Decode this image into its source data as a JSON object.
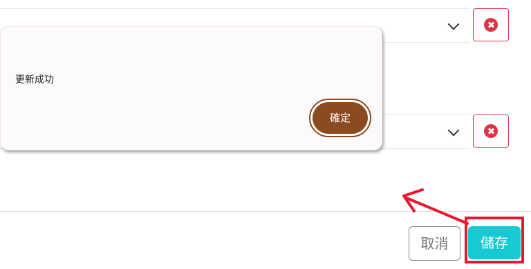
{
  "dialog": {
    "message": "更新成功",
    "confirm_label": "確定"
  },
  "form": {
    "rows": [
      {
        "remove_icon": "x-circle-icon"
      },
      {
        "remove_icon": "x-circle-icon"
      }
    ]
  },
  "footer": {
    "cancel_label": "取消",
    "save_label": "儲存"
  },
  "annotation": {
    "color": "#e8162f"
  },
  "colors": {
    "danger": "#dc3545",
    "save": "#16c9d2",
    "confirm": "#8b4a1f"
  }
}
